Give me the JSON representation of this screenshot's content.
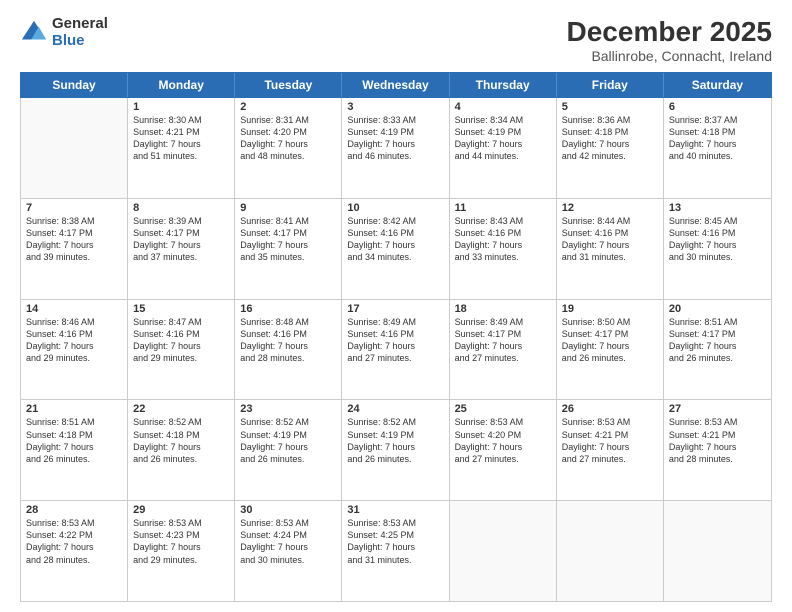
{
  "logo": {
    "general": "General",
    "blue": "Blue"
  },
  "title": "December 2025",
  "subtitle": "Ballinrobe, Connacht, Ireland",
  "days": [
    "Sunday",
    "Monday",
    "Tuesday",
    "Wednesday",
    "Thursday",
    "Friday",
    "Saturday"
  ],
  "rows": [
    [
      {
        "day": "",
        "empty": true
      },
      {
        "day": "1",
        "sunrise": "8:30 AM",
        "sunset": "4:21 PM",
        "daylight": "7 hours and 51 minutes."
      },
      {
        "day": "2",
        "sunrise": "8:31 AM",
        "sunset": "4:20 PM",
        "daylight": "7 hours and 48 minutes."
      },
      {
        "day": "3",
        "sunrise": "8:33 AM",
        "sunset": "4:19 PM",
        "daylight": "7 hours and 46 minutes."
      },
      {
        "day": "4",
        "sunrise": "8:34 AM",
        "sunset": "4:19 PM",
        "daylight": "7 hours and 44 minutes."
      },
      {
        "day": "5",
        "sunrise": "8:36 AM",
        "sunset": "4:18 PM",
        "daylight": "7 hours and 42 minutes."
      },
      {
        "day": "6",
        "sunrise": "8:37 AM",
        "sunset": "4:18 PM",
        "daylight": "7 hours and 40 minutes."
      }
    ],
    [
      {
        "day": "7",
        "sunrise": "8:38 AM",
        "sunset": "4:17 PM",
        "daylight": "7 hours and 39 minutes."
      },
      {
        "day": "8",
        "sunrise": "8:39 AM",
        "sunset": "4:17 PM",
        "daylight": "7 hours and 37 minutes."
      },
      {
        "day": "9",
        "sunrise": "8:41 AM",
        "sunset": "4:17 PM",
        "daylight": "7 hours and 35 minutes."
      },
      {
        "day": "10",
        "sunrise": "8:42 AM",
        "sunset": "4:16 PM",
        "daylight": "7 hours and 34 minutes."
      },
      {
        "day": "11",
        "sunrise": "8:43 AM",
        "sunset": "4:16 PM",
        "daylight": "7 hours and 33 minutes."
      },
      {
        "day": "12",
        "sunrise": "8:44 AM",
        "sunset": "4:16 PM",
        "daylight": "7 hours and 31 minutes."
      },
      {
        "day": "13",
        "sunrise": "8:45 AM",
        "sunset": "4:16 PM",
        "daylight": "7 hours and 30 minutes."
      }
    ],
    [
      {
        "day": "14",
        "sunrise": "8:46 AM",
        "sunset": "4:16 PM",
        "daylight": "7 hours and 29 minutes."
      },
      {
        "day": "15",
        "sunrise": "8:47 AM",
        "sunset": "4:16 PM",
        "daylight": "7 hours and 29 minutes."
      },
      {
        "day": "16",
        "sunrise": "8:48 AM",
        "sunset": "4:16 PM",
        "daylight": "7 hours and 28 minutes."
      },
      {
        "day": "17",
        "sunrise": "8:49 AM",
        "sunset": "4:16 PM",
        "daylight": "7 hours and 27 minutes."
      },
      {
        "day": "18",
        "sunrise": "8:49 AM",
        "sunset": "4:17 PM",
        "daylight": "7 hours and 27 minutes."
      },
      {
        "day": "19",
        "sunrise": "8:50 AM",
        "sunset": "4:17 PM",
        "daylight": "7 hours and 26 minutes."
      },
      {
        "day": "20",
        "sunrise": "8:51 AM",
        "sunset": "4:17 PM",
        "daylight": "7 hours and 26 minutes."
      }
    ],
    [
      {
        "day": "21",
        "sunrise": "8:51 AM",
        "sunset": "4:18 PM",
        "daylight": "7 hours and 26 minutes."
      },
      {
        "day": "22",
        "sunrise": "8:52 AM",
        "sunset": "4:18 PM",
        "daylight": "7 hours and 26 minutes."
      },
      {
        "day": "23",
        "sunrise": "8:52 AM",
        "sunset": "4:19 PM",
        "daylight": "7 hours and 26 minutes."
      },
      {
        "day": "24",
        "sunrise": "8:52 AM",
        "sunset": "4:19 PM",
        "daylight": "7 hours and 26 minutes."
      },
      {
        "day": "25",
        "sunrise": "8:53 AM",
        "sunset": "4:20 PM",
        "daylight": "7 hours and 27 minutes."
      },
      {
        "day": "26",
        "sunrise": "8:53 AM",
        "sunset": "4:21 PM",
        "daylight": "7 hours and 27 minutes."
      },
      {
        "day": "27",
        "sunrise": "8:53 AM",
        "sunset": "4:21 PM",
        "daylight": "7 hours and 28 minutes."
      }
    ],
    [
      {
        "day": "28",
        "sunrise": "8:53 AM",
        "sunset": "4:22 PM",
        "daylight": "7 hours and 28 minutes."
      },
      {
        "day": "29",
        "sunrise": "8:53 AM",
        "sunset": "4:23 PM",
        "daylight": "7 hours and 29 minutes."
      },
      {
        "day": "30",
        "sunrise": "8:53 AM",
        "sunset": "4:24 PM",
        "daylight": "7 hours and 30 minutes."
      },
      {
        "day": "31",
        "sunrise": "8:53 AM",
        "sunset": "4:25 PM",
        "daylight": "7 hours and 31 minutes."
      },
      {
        "day": "",
        "empty": true
      },
      {
        "day": "",
        "empty": true
      },
      {
        "day": "",
        "empty": true
      }
    ]
  ],
  "labels": {
    "sunrise": "Sunrise:",
    "sunset": "Sunset:",
    "daylight": "Daylight:"
  }
}
